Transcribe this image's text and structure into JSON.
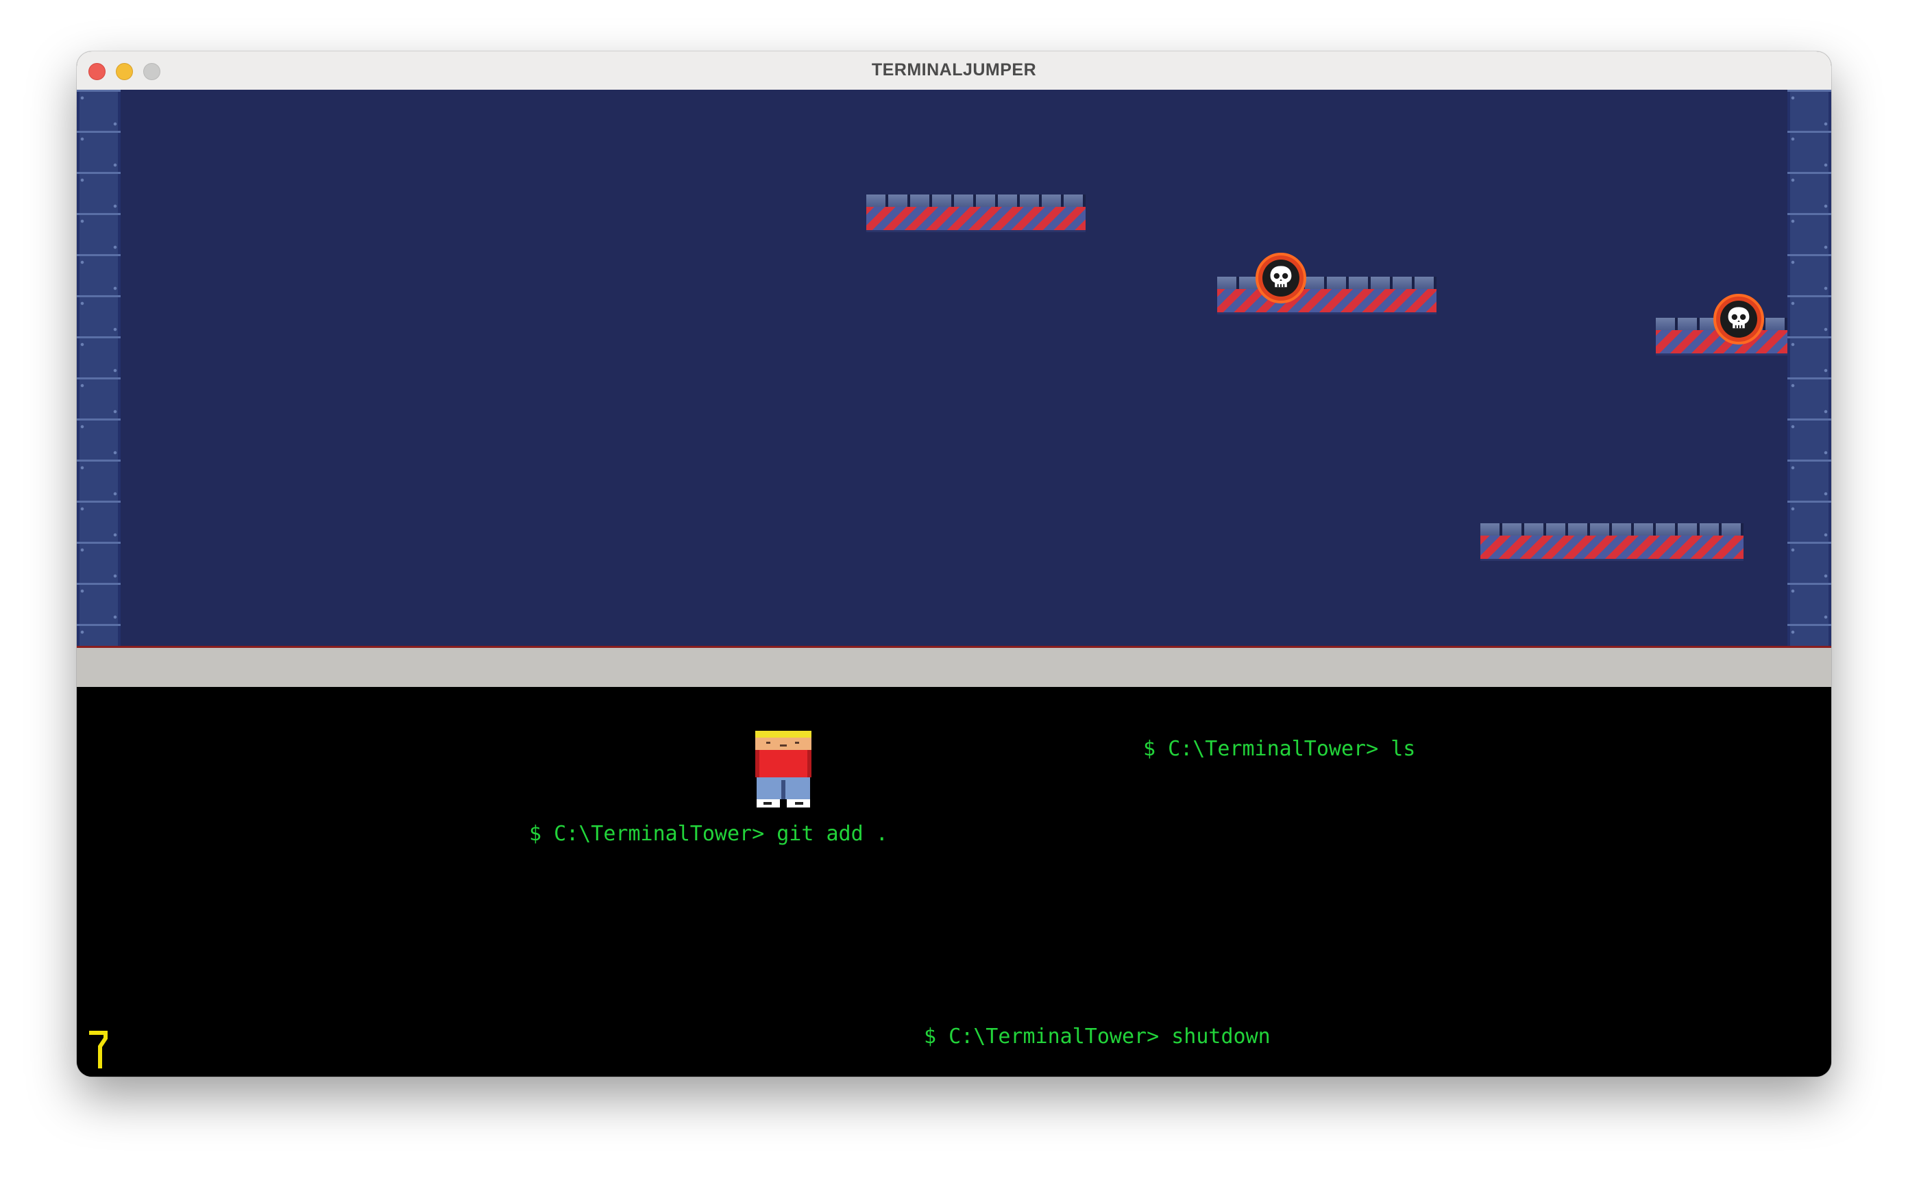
{
  "window": {
    "title": "TERMINALJUMPER",
    "controls": [
      "close-button",
      "minimize-button",
      "maximize-button"
    ]
  },
  "game": {
    "background_color": "#222a5a",
    "platforms": [
      "platform",
      "platform",
      "platform",
      "platform"
    ],
    "enemies": [
      "skull-enemy",
      "skull-enemy"
    ],
    "accent_colors": {
      "stripe_red": "#d8323a",
      "stripe_blue": "#4a5aa0",
      "enemy_ring": "#ff6a22"
    }
  },
  "terminal": {
    "text_color": "#22d43a",
    "commands": [
      {
        "text": "$ C:\\TerminalTower> ls"
      },
      {
        "text": "$ C:\\TerminalTower> git add ."
      },
      {
        "text": "$ C:\\TerminalTower> shutdown"
      }
    ],
    "player": {
      "icon": "player-character-icon"
    },
    "caret": {
      "icon": "yellow-caret-icon",
      "color": "#f2e20a"
    }
  }
}
